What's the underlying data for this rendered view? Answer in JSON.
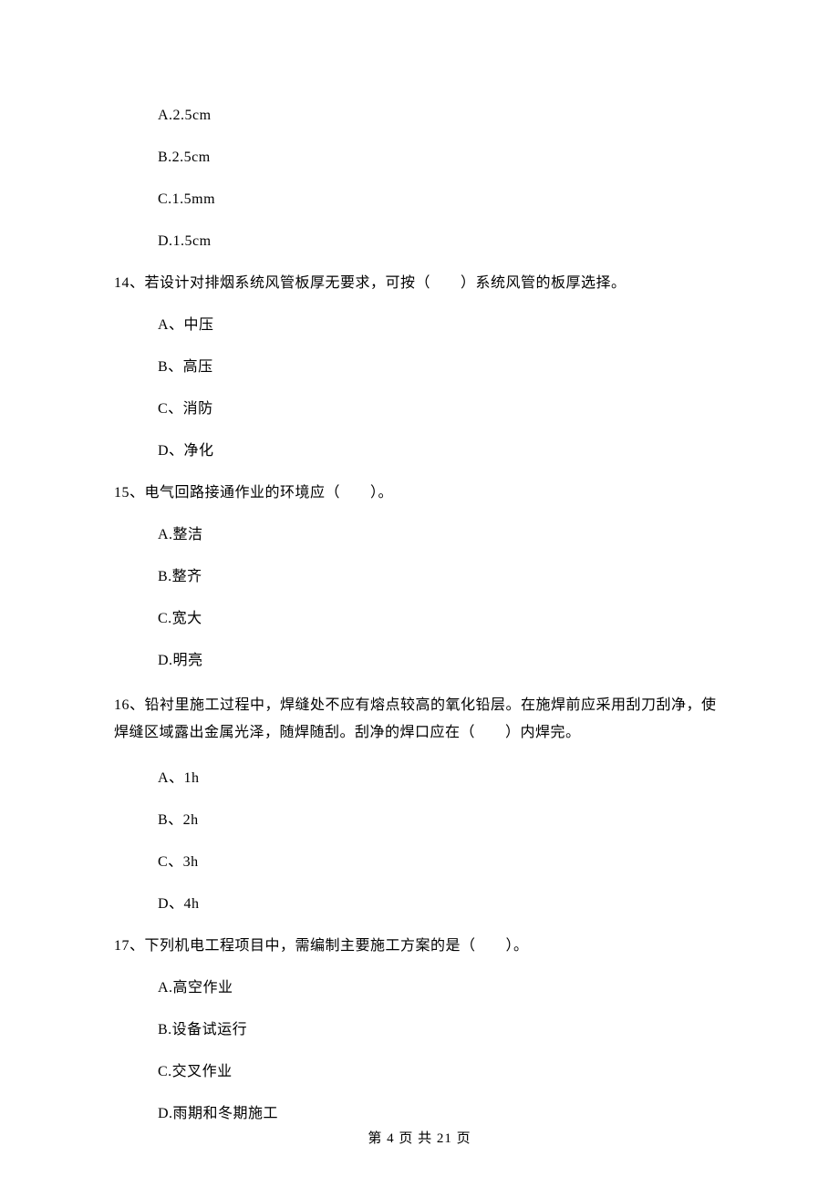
{
  "q13": {
    "options": {
      "a": "A.2.5cm",
      "b": "B.2.5cm",
      "c": "C.1.5mm",
      "d": "D.1.5cm"
    }
  },
  "q14": {
    "text": "14、若设计对排烟系统风管板厚无要求，可按（　　）系统风管的板厚选择。",
    "options": {
      "a": "A、中压",
      "b": "B、高压",
      "c": "C、消防",
      "d": "D、净化"
    }
  },
  "q15": {
    "text": "15、电气回路接通作业的环境应（　　）。",
    "options": {
      "a": "A.整洁",
      "b": "B.整齐",
      "c": "C.宽大",
      "d": "D.明亮"
    }
  },
  "q16": {
    "text": "16、铅衬里施工过程中，焊缝处不应有熔点较高的氧化铅层。在施焊前应采用刮刀刮净，使焊缝区域露出金属光泽，随焊随刮。刮净的焊口应在（　　）内焊完。",
    "options": {
      "a": "A、1h",
      "b": "B、2h",
      "c": "C、3h",
      "d": "D、4h"
    }
  },
  "q17": {
    "text": "17、下列机电工程项目中，需编制主要施工方案的是（　　）。",
    "options": {
      "a": "A.高空作业",
      "b": "B.设备试运行",
      "c": "C.交叉作业",
      "d": "D.雨期和冬期施工"
    }
  },
  "footer": "第 4 页 共 21 页"
}
